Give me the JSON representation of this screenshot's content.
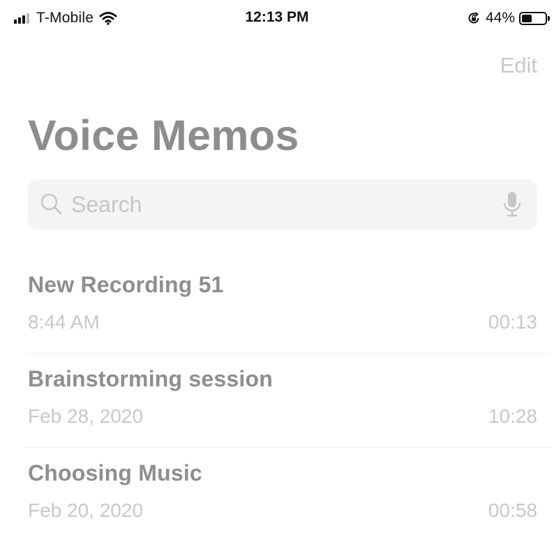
{
  "status_bar": {
    "carrier": "T-Mobile",
    "time": "12:13 PM",
    "battery_percent": "44%",
    "battery_level": 0.44,
    "signal_bars_active": 3,
    "signal_bars_total": 4,
    "icons": [
      "signal-icon",
      "wifi-icon",
      "orientation-lock-icon",
      "battery-icon"
    ]
  },
  "nav": {
    "edit_label": "Edit"
  },
  "header": {
    "title": "Voice Memos"
  },
  "search": {
    "placeholder": "Search",
    "value": "",
    "icon": "search-icon",
    "mic_icon": "microphone-icon"
  },
  "recordings": [
    {
      "title": "New Recording 51",
      "date": "8:44 AM",
      "duration": "00:13"
    },
    {
      "title": "Brainstorming session",
      "date": "Feb 28, 2020",
      "duration": "10:28"
    },
    {
      "title": "Choosing Music",
      "date": "Feb 20, 2020",
      "duration": "00:58"
    }
  ],
  "colors": {
    "title_text": "#8d8d8d",
    "secondary_text": "#c8c8c8",
    "search_background": "#f4f4f5",
    "status_text": "#111111"
  }
}
